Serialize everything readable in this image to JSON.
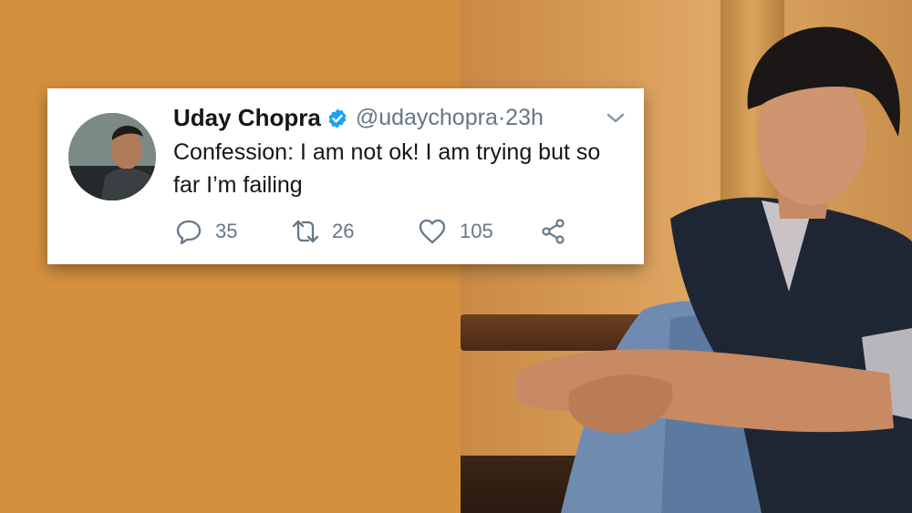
{
  "tweet": {
    "display_name": "Uday Chopra",
    "handle": "@udaychopra",
    "separator": " · ",
    "time": "23h",
    "text": "Confession: I am not ok! I am trying but so far I’m failing",
    "replies": "35",
    "retweets": "26",
    "likes": "105"
  },
  "icons": {
    "verified": "verified-badge-icon",
    "menu": "chevron-down-icon",
    "reply": "reply-icon",
    "retweet": "retweet-icon",
    "like": "heart-icon",
    "share": "share-icon"
  },
  "colors": {
    "background": "#d4903f",
    "card": "#ffffff",
    "verified": "#1da1f2",
    "text": "#14171a",
    "muted": "#657786"
  }
}
